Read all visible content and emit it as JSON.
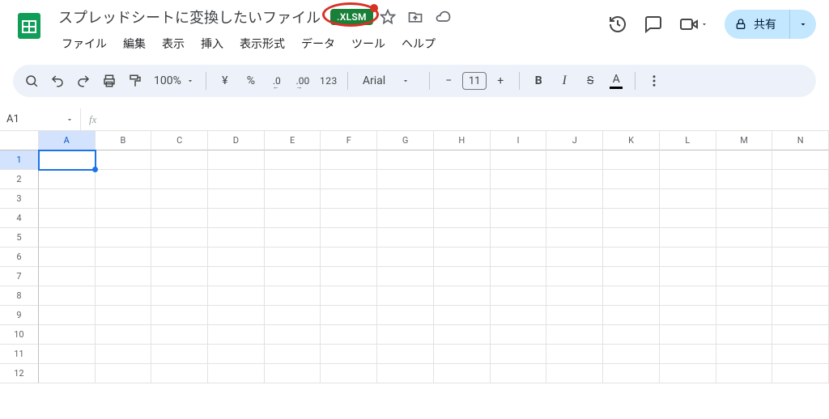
{
  "doc": {
    "title": "スプレッドシートに変換したいファイル",
    "badge": ".XLSM"
  },
  "menus": [
    "ファイル",
    "編集",
    "表示",
    "挿入",
    "表示形式",
    "データ",
    "ツール",
    "ヘルプ"
  ],
  "share_label": "共有",
  "toolbar": {
    "zoom": "100%",
    "currency": "¥",
    "percent": "%",
    "dec_minus": ".0",
    "dec_plus": ".00",
    "numfmt": "123",
    "font": "Arial",
    "font_size": "11",
    "bold": "B",
    "italic": "I",
    "strike": "S",
    "textcolor": "A"
  },
  "namebox": "A1",
  "columns": [
    "A",
    "B",
    "C",
    "D",
    "E",
    "F",
    "G",
    "H",
    "I",
    "J",
    "K",
    "L",
    "M",
    "N"
  ],
  "rows": [
    "1",
    "2",
    "3",
    "4",
    "5",
    "6",
    "7",
    "8",
    "9",
    "10",
    "11",
    "12"
  ],
  "selected": {
    "col": "A",
    "row": "1"
  }
}
